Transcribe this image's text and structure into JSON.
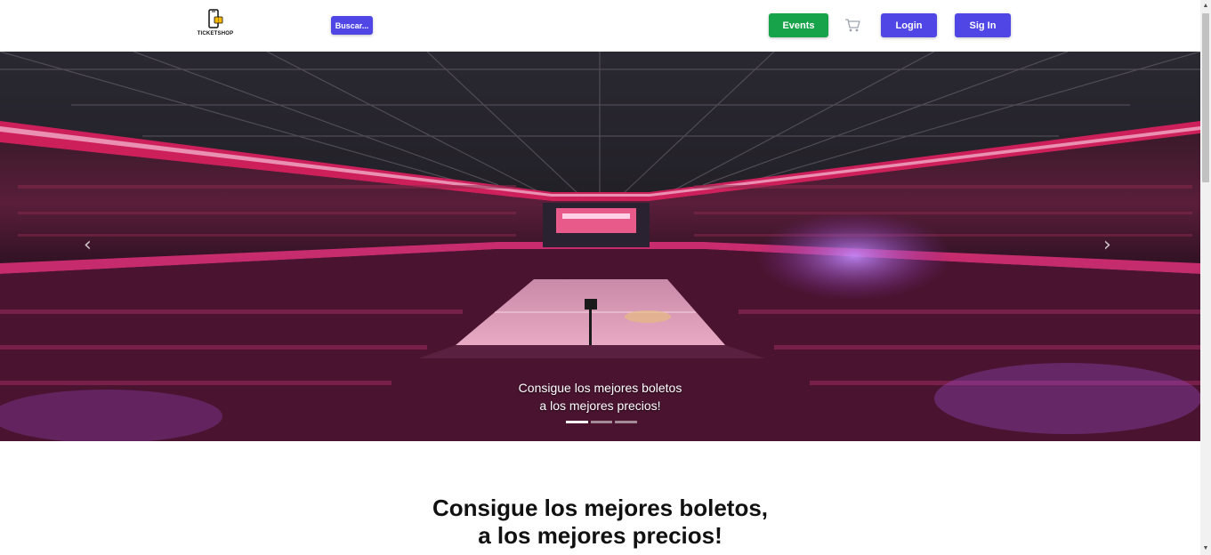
{
  "header": {
    "logo_text": "TICKETSHOP",
    "search_button": "Buscar...",
    "events_button": "Events",
    "login_button": "Login",
    "signin_button": "Sig In",
    "icons": [
      "phone-ticket-logo-icon",
      "shopping-cart-icon"
    ]
  },
  "colors": {
    "search": "#4f46e5",
    "events": "#16a34a",
    "login": "#4f46e5",
    "signin": "#4f46e5"
  },
  "hero": {
    "caption_line1": "Consigue los mejores boletos",
    "caption_line2": "a los mejores precios!",
    "prev_arrow": "‹",
    "next_arrow": "›",
    "slides": 3,
    "active_slide": 1
  },
  "main": {
    "headline_line1": "Consigue los mejores boletos,",
    "headline_line2": "a los mejores precios!"
  },
  "scrollbar": {
    "up_arrow": "▲",
    "down_arrow": "▼"
  }
}
